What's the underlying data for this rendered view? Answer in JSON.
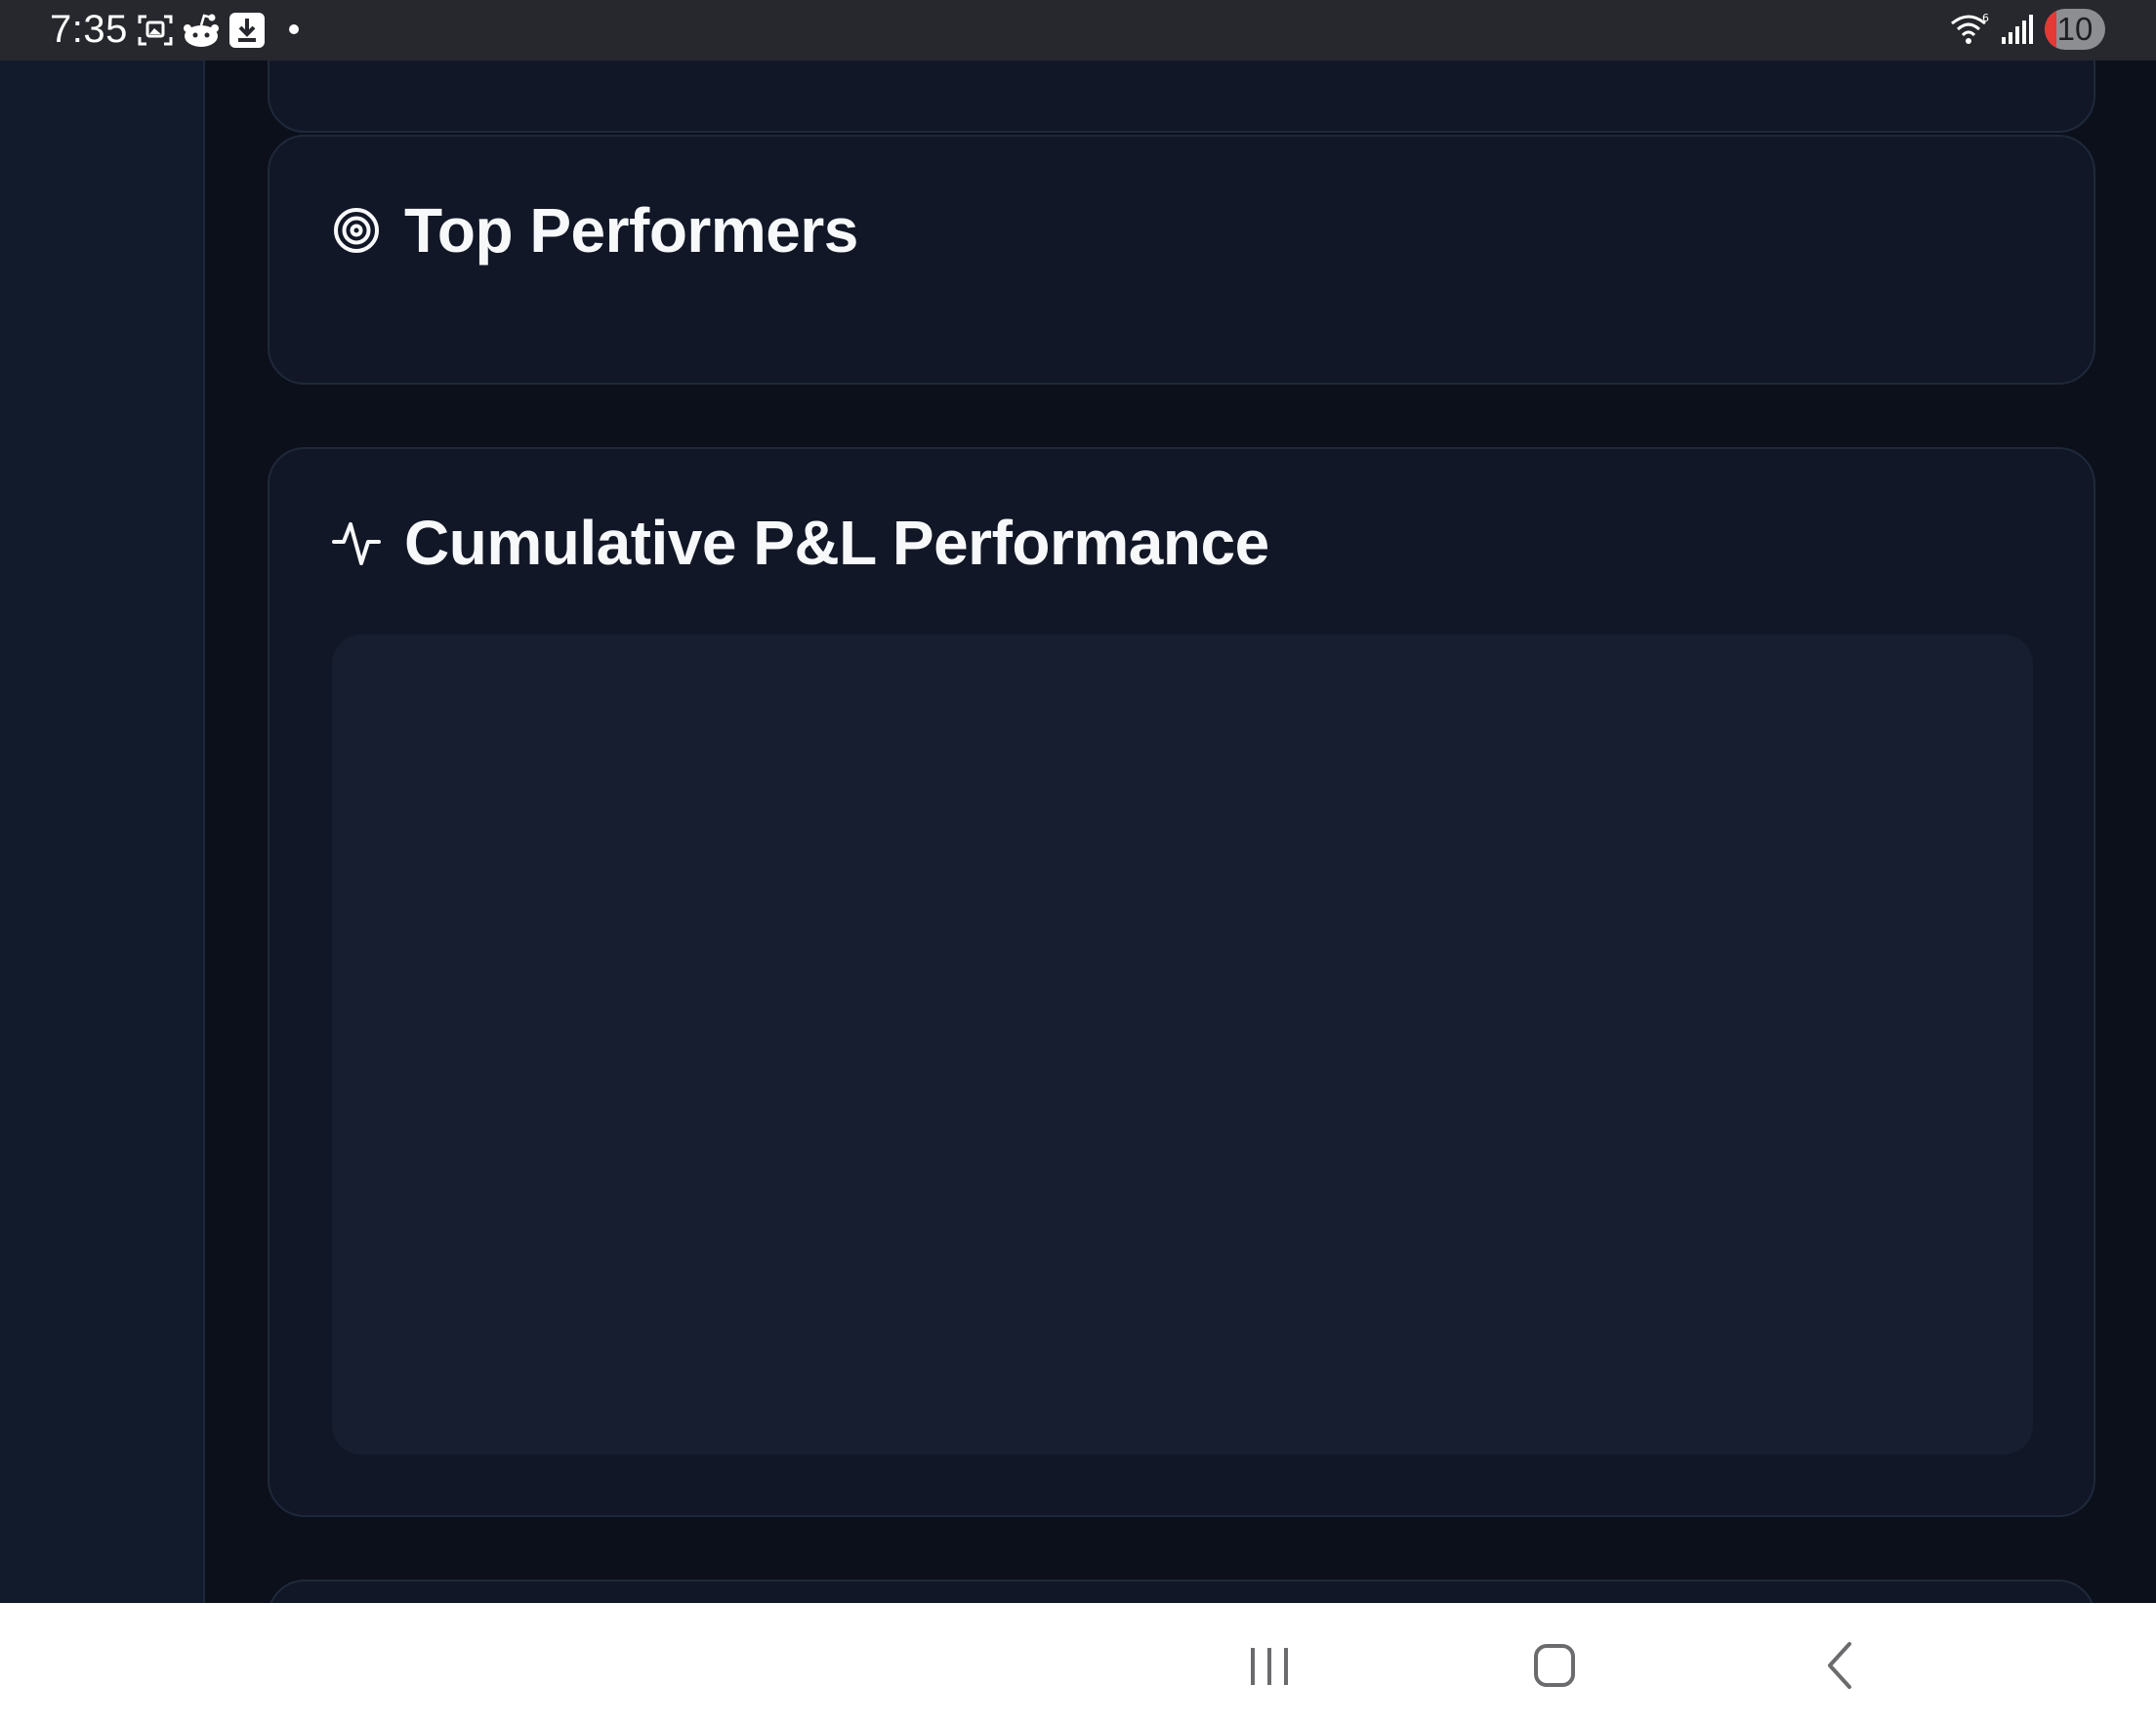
{
  "status_bar": {
    "time": "7:35",
    "left_icons": [
      "screenshot-icon",
      "reddit-icon",
      "download-icon",
      "notification-dot"
    ],
    "right_icons": [
      "wifi-icon",
      "signal-icon"
    ],
    "battery_level": "10",
    "battery_color": "#e53935"
  },
  "cards": {
    "top_performers": {
      "title": "Top Performers",
      "icon": "target-icon"
    },
    "cumulative_pnl": {
      "title": "Cumulative P&L Performance",
      "icon": "activity-icon"
    }
  },
  "nav_bar": {
    "buttons": [
      "recents-icon",
      "home-icon",
      "back-icon"
    ]
  },
  "colors": {
    "background": "#0b101b",
    "sidebar": "#121b2c",
    "card": "#111726",
    "card_border": "#1f293b",
    "chart_area": "#161e2f",
    "title_text": "#f7f8fa"
  }
}
